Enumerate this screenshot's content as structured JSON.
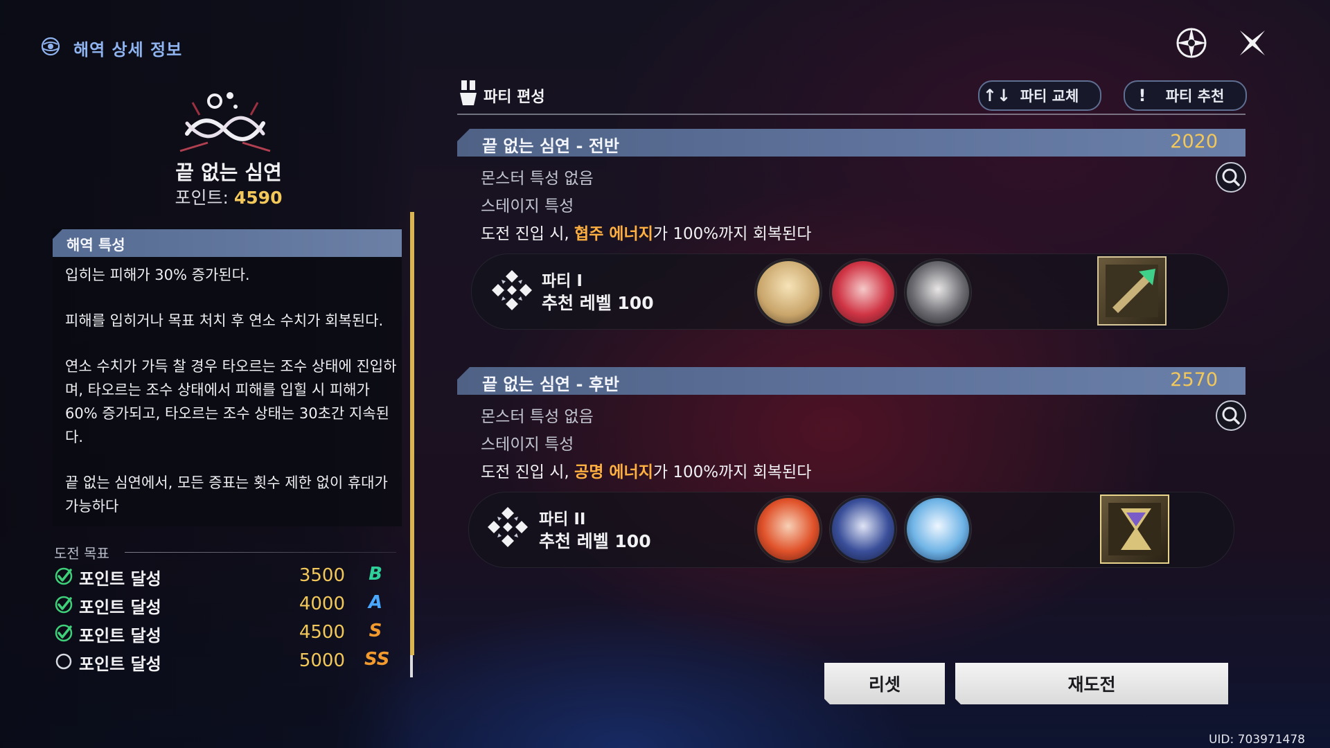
{
  "left": {
    "title": "해역 상세 정보",
    "stage_name": "끝 없는 심연",
    "points_label": "포인트: ",
    "points_value": "4590",
    "traits_header": "해역 특성",
    "traits": [
      "입히는 피해가 30% 증가된다.",
      "피해를 입히거나 목표 처치 후 연소 수치가 회복된다.",
      "연소 수치가 가득 찰 경우 타오르는 조수 상태에 진입하며, 타오르는 조수 상태에서 피해를 입힐 시 피해가 60% 증가되고, 타오르는 조수 상태는 30초간 지속된다.",
      "끝 없는 심연에서, 모든 증표는 횟수 제한 없이 휴대가 가능하다"
    ],
    "goals_title": "도전 목표",
    "goals": [
      {
        "label": "포인트 달성",
        "value": "3500",
        "rank": "B",
        "rank_color": "#2fcf9a",
        "achieved": true
      },
      {
        "label": "포인트 달성",
        "value": "4000",
        "rank": "A",
        "rank_color": "#4aa8ff",
        "achieved": true
      },
      {
        "label": "포인트 달성",
        "value": "4500",
        "rank": "S",
        "rank_color": "#f29a2e",
        "achieved": true
      },
      {
        "label": "포인트 달성",
        "value": "5000",
        "rank": "SS",
        "rank_color": "#f29a2e",
        "achieved": false
      }
    ]
  },
  "party": {
    "title": "파티 편성",
    "swap_label": "파티 교체",
    "swap_icon": "↑↓",
    "recommend_label": "파티 추천",
    "recommend_icon": "!"
  },
  "sections": [
    {
      "title": "끝 없는 심연 - 전반",
      "score": "2020",
      "monster_trait": "몬스터 특성 없음",
      "stage_trait_label": "스테이지 특성",
      "desc_prefix": "도전 진입 시, ",
      "desc_highlight": "협주 에너지",
      "desc_suffix": "가 100%까지 회복된다",
      "party_name": "파티 I",
      "party_level": "추천 레벨 100"
    },
    {
      "title": "끝 없는 심연 - 후반",
      "score": "2570",
      "monster_trait": "몬스터 특성 없음",
      "stage_trait_label": "스테이지 특성",
      "desc_prefix": "도전 진입 시, ",
      "desc_highlight": "공명 에너지",
      "desc_suffix": "가 100%까지 회복된다",
      "party_name": "파티 II",
      "party_level": "추천 레벨 100"
    }
  ],
  "buttons": {
    "reset": "리셋",
    "retry": "재도전"
  },
  "uid": "UID: 703971478",
  "colors": {
    "accent_gold": "#f3c85a",
    "highlight_orange": "#ffb040",
    "section_bar": "#5d719a"
  }
}
